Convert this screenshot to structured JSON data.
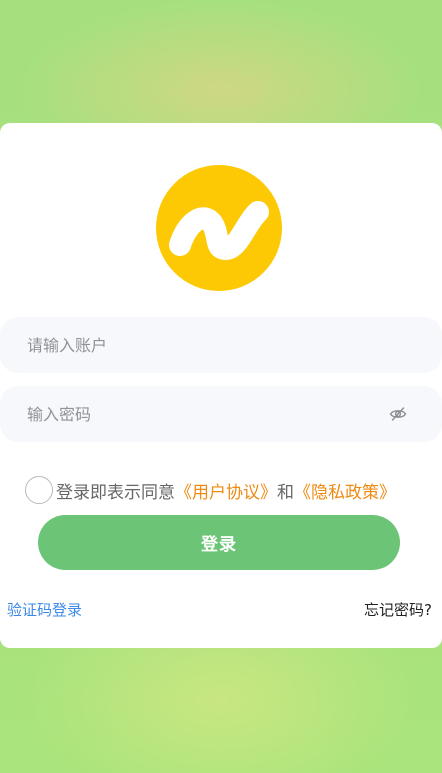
{
  "logo": {
    "icon": "wave-n-logo",
    "bg_color": "#fcc904",
    "mark_color": "#ffffff"
  },
  "form": {
    "account_placeholder": "请输入账户",
    "password_placeholder": "输入密码",
    "password_toggle_icon": "eye-off-icon"
  },
  "agreement": {
    "prefix": "登录即表示同意",
    "user_agreement": "《用户协议》",
    "and": "和",
    "privacy_policy": "《隐私政策》",
    "checked": false,
    "link_color": "#ef8a12"
  },
  "login_button": {
    "label": "登录",
    "color": "#6cc476"
  },
  "footer": {
    "sms_login": "验证码登录",
    "forgot_password": "忘记密码?"
  }
}
